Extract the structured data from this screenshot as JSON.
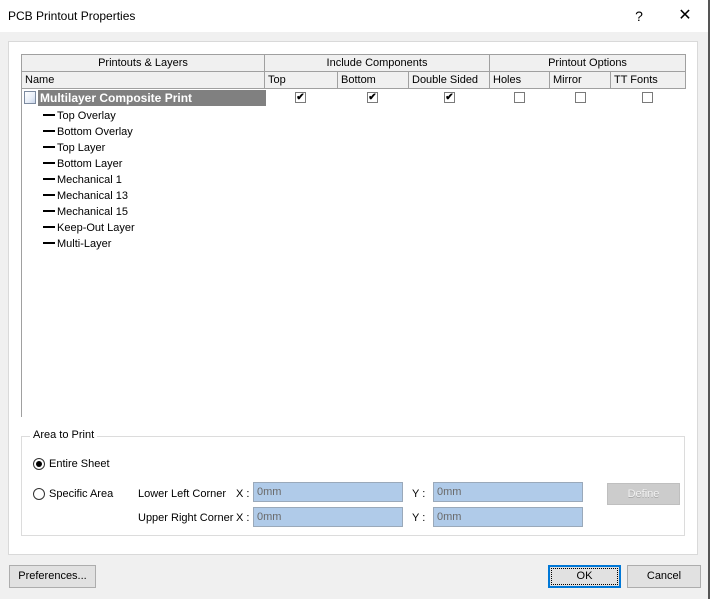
{
  "window": {
    "title": "PCB Printout Properties",
    "help_label": "?",
    "close_label": "✕"
  },
  "table": {
    "group_headers": [
      {
        "label": "Printouts & Layers"
      },
      {
        "label": "Include Components"
      },
      {
        "label": "Printout Options"
      }
    ],
    "columns": [
      {
        "label": "Name"
      },
      {
        "label": "Top"
      },
      {
        "label": "Bottom"
      },
      {
        "label": "Double Sided"
      },
      {
        "label": "Holes"
      },
      {
        "label": "Mirror"
      },
      {
        "label": "TT Fonts"
      }
    ],
    "root": {
      "label": "Multilayer Composite Print",
      "icon": "document-icon",
      "top": true,
      "bottom": true,
      "double_sided": true,
      "holes": false,
      "mirror": false,
      "tt_fonts": false
    },
    "layers": [
      {
        "label": "Top Overlay"
      },
      {
        "label": "Bottom Overlay"
      },
      {
        "label": "Top Layer"
      },
      {
        "label": "Bottom Layer"
      },
      {
        "label": "Mechanical 1"
      },
      {
        "label": "Mechanical 13"
      },
      {
        "label": "Mechanical 15"
      },
      {
        "label": "Keep-Out Layer"
      },
      {
        "label": "Multi-Layer"
      }
    ]
  },
  "area_to_print": {
    "group_label": "Area to Print",
    "entire_sheet_label": "Entire Sheet",
    "entire_sheet_selected": true,
    "specific_area_label": "Specific Area",
    "specific_area_selected": false,
    "lower_left_label": "Lower Left Corner",
    "upper_right_label": "Upper Right Corner",
    "x_label": "X :",
    "y_label": "Y :",
    "lower_left_x": "0mm",
    "lower_left_y": "0mm",
    "upper_right_x": "0mm",
    "upper_right_y": "0mm",
    "define_label": "Define"
  },
  "buttons": {
    "preferences": "Preferences...",
    "ok": "OK",
    "cancel": "Cancel"
  }
}
